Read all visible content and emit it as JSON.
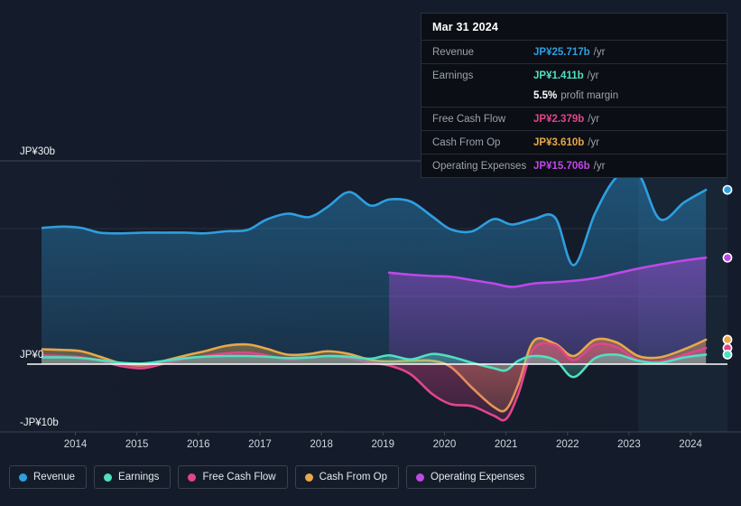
{
  "colors": {
    "revenue": "#2e9fe0",
    "earnings": "#4fe0c0",
    "free_cash_flow": "#e0468c",
    "cash_from_op": "#e8a84a",
    "operating_expenses": "#bf48e8",
    "background": "#141b2a",
    "plot_background": "#151d2c",
    "zero_line": "#ffffff",
    "grid": "#46515f"
  },
  "tooltip": {
    "date": "Mar 31 2024",
    "rows": [
      {
        "label": "Revenue",
        "value": "JP¥25.717b",
        "unit": "/yr",
        "color": "#2e9fe0"
      },
      {
        "label": "Earnings",
        "value": "JP¥1.411b",
        "unit": "/yr",
        "color": "#4fe0c0"
      },
      {
        "label": "",
        "value": "5.5%",
        "unit": "profit margin",
        "color": "#ffffff",
        "sub": true
      },
      {
        "label": "Free Cash Flow",
        "value": "JP¥2.379b",
        "unit": "/yr",
        "color": "#e0468c"
      },
      {
        "label": "Cash From Op",
        "value": "JP¥3.610b",
        "unit": "/yr",
        "color": "#e8a84a"
      },
      {
        "label": "Operating Expenses",
        "value": "JP¥15.706b",
        "unit": "/yr",
        "color": "#bf48e8"
      }
    ]
  },
  "legend": [
    {
      "label": "Revenue",
      "color": "#2e9fe0"
    },
    {
      "label": "Earnings",
      "color": "#4fe0c0"
    },
    {
      "label": "Free Cash Flow",
      "color": "#e0468c"
    },
    {
      "label": "Cash From Op",
      "color": "#e8a84a"
    },
    {
      "label": "Operating Expenses",
      "color": "#bf48e8"
    }
  ],
  "chart_data": {
    "type": "area",
    "title": "",
    "xlabel": "",
    "ylabel": "",
    "currency": "JP¥",
    "units": "billions",
    "ylim": [
      -13.5,
      30
    ],
    "yticks": [
      30,
      0,
      -10
    ],
    "ytick_labels": [
      "JP¥30b",
      "JP¥0",
      "-JP¥10b"
    ],
    "gridlines": [
      30,
      20,
      10,
      0,
      -10
    ],
    "grid": true,
    "legend_position": "bottom",
    "xlim": [
      2013.45,
      2024.6
    ],
    "xticks": [
      2014,
      2015,
      2016,
      2017,
      2018,
      2019,
      2020,
      2021,
      2022,
      2023,
      2024
    ],
    "xtick_labels": [
      "2014",
      "2015",
      "2016",
      "2017",
      "2018",
      "2019",
      "2020",
      "2021",
      "2022",
      "2023",
      "2024"
    ],
    "forecast_start_x": 2023.15,
    "series": [
      {
        "name": "Revenue",
        "color": "#2e9fe0",
        "fill": true,
        "x": [
          2013.45,
          2013.8,
          2014.1,
          2014.4,
          2014.75,
          2015.1,
          2015.45,
          2015.8,
          2016.1,
          2016.45,
          2016.8,
          2017.1,
          2017.45,
          2017.8,
          2018.1,
          2018.45,
          2018.8,
          2019.1,
          2019.45,
          2019.8,
          2020.1,
          2020.45,
          2020.8,
          2021.1,
          2021.45,
          2021.8,
          2022.1,
          2022.45,
          2022.8,
          2023.15,
          2023.5,
          2023.9,
          2024.25
        ],
        "y": [
          20.1,
          20.3,
          20.1,
          19.4,
          19.3,
          19.4,
          19.4,
          19.4,
          19.3,
          19.6,
          19.8,
          21.3,
          22.2,
          21.7,
          23.2,
          25.4,
          23.4,
          24.3,
          24.0,
          21.8,
          19.9,
          19.6,
          21.4,
          20.6,
          21.4,
          21.6,
          14.6,
          22.3,
          27.6,
          28.1,
          21.4,
          23.9,
          25.72
        ]
      },
      {
        "name": "Operating Expenses",
        "color": "#bf48e8",
        "fill": true,
        "x": [
          2019.1,
          2019.45,
          2019.8,
          2020.1,
          2020.45,
          2020.8,
          2021.1,
          2021.45,
          2021.8,
          2022.1,
          2022.45,
          2022.8,
          2023.15,
          2023.5,
          2023.9,
          2024.25
        ],
        "y": [
          13.5,
          13.2,
          13.0,
          12.9,
          12.4,
          11.9,
          11.4,
          11.9,
          12.1,
          12.3,
          12.7,
          13.4,
          14.1,
          14.7,
          15.3,
          15.71
        ]
      },
      {
        "name": "Cash From Op",
        "color": "#e8a84a",
        "fill": true,
        "x": [
          2013.45,
          2013.8,
          2014.1,
          2014.4,
          2014.75,
          2015.1,
          2015.45,
          2015.8,
          2016.1,
          2016.45,
          2016.8,
          2017.1,
          2017.45,
          2017.8,
          2018.1,
          2018.45,
          2018.8,
          2019.1,
          2019.45,
          2019.8,
          2020.1,
          2020.45,
          2020.8,
          2021.0,
          2021.2,
          2021.45,
          2021.8,
          2022.1,
          2022.45,
          2022.8,
          2023.15,
          2023.5,
          2023.9,
          2024.25
        ],
        "y": [
          2.2,
          2.1,
          1.9,
          1.1,
          0.1,
          -0.2,
          0.5,
          1.3,
          1.9,
          2.7,
          2.9,
          2.3,
          1.4,
          1.5,
          1.9,
          1.5,
          0.6,
          0.4,
          0.5,
          0.5,
          -0.4,
          -3.5,
          -6.3,
          -6.7,
          -3.0,
          3.4,
          3.0,
          1.2,
          3.6,
          3.2,
          1.2,
          1.0,
          2.2,
          3.61
        ]
      },
      {
        "name": "Free Cash Flow",
        "color": "#e0468c",
        "fill": true,
        "x": [
          2013.45,
          2013.8,
          2014.1,
          2014.4,
          2014.75,
          2015.1,
          2015.45,
          2015.8,
          2016.1,
          2016.45,
          2016.8,
          2017.1,
          2017.45,
          2017.8,
          2018.1,
          2018.45,
          2018.8,
          2019.1,
          2019.45,
          2019.8,
          2020.1,
          2020.45,
          2020.8,
          2021.0,
          2021.2,
          2021.45,
          2021.8,
          2022.1,
          2022.45,
          2022.8,
          2023.15,
          2023.5,
          2023.9,
          2024.25
        ],
        "y": [
          1.3,
          1.2,
          1.0,
          0.5,
          -0.3,
          -0.6,
          0.1,
          0.8,
          1.2,
          1.6,
          1.7,
          1.3,
          0.7,
          0.9,
          1.2,
          0.9,
          0.2,
          -0.2,
          -1.5,
          -4.4,
          -5.9,
          -6.2,
          -7.6,
          -8.1,
          -4.4,
          2.3,
          2.8,
          0.6,
          2.9,
          2.5,
          0.6,
          0.4,
          1.4,
          2.38
        ]
      },
      {
        "name": "Earnings",
        "color": "#4fe0c0",
        "fill": true,
        "x": [
          2013.45,
          2013.8,
          2014.1,
          2014.4,
          2014.75,
          2015.1,
          2015.45,
          2015.8,
          2016.1,
          2016.45,
          2016.8,
          2017.1,
          2017.45,
          2017.8,
          2018.1,
          2018.45,
          2018.8,
          2019.1,
          2019.45,
          2019.8,
          2020.1,
          2020.45,
          2020.8,
          2021.0,
          2021.2,
          2021.45,
          2021.8,
          2022.1,
          2022.45,
          2022.8,
          2023.15,
          2023.5,
          2023.9,
          2024.25
        ],
        "y": [
          1.0,
          1.0,
          0.9,
          0.6,
          0.2,
          0.1,
          0.5,
          0.9,
          1.1,
          1.2,
          1.2,
          1.1,
          0.9,
          1.0,
          1.2,
          1.1,
          0.8,
          1.3,
          0.7,
          1.5,
          1.1,
          0.2,
          -0.6,
          -0.9,
          0.5,
          1.2,
          0.6,
          -1.9,
          0.9,
          1.4,
          0.5,
          0.2,
          1.0,
          1.41
        ]
      }
    ],
    "end_markers": [
      {
        "name": "Revenue",
        "value": 25.72,
        "color": "#2e9fe0"
      },
      {
        "name": "Operating Expenses",
        "value": 15.71,
        "color": "#bf48e8"
      },
      {
        "name": "Cash From Op",
        "value": 3.61,
        "color": "#e8a84a"
      },
      {
        "name": "Free Cash Flow",
        "value": 2.38,
        "color": "#e0468c"
      },
      {
        "name": "Earnings",
        "value": 1.41,
        "color": "#4fe0c0"
      }
    ]
  }
}
